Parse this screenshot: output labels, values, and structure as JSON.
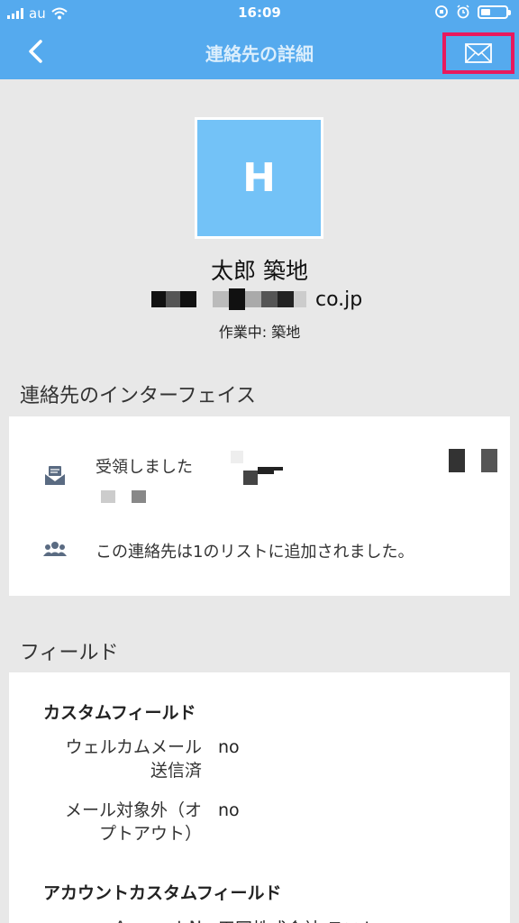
{
  "status_bar": {
    "carrier": "au",
    "time": "16:09",
    "battery_level": 0.4
  },
  "header": {
    "back_icon": "chevron-left-icon",
    "title": "連絡先の詳細",
    "mail_icon": "envelope-icon"
  },
  "contact": {
    "avatar_initial": "H",
    "name": "太郎 築地",
    "email_domain": "co.jp",
    "work": "作業中: 築地"
  },
  "interface_section": {
    "title": "連絡先のインターフェイス",
    "items": [
      {
        "icon": "mail-received-icon",
        "text": "受領しました"
      },
      {
        "icon": "people-icon",
        "text": "この連絡先は1のリストに追加されました。"
      }
    ]
  },
  "fields_section": {
    "title": "フィールド",
    "custom_title": "カスタムフィールド",
    "custom_fields": [
      {
        "label_line1": "ウェルカムメール",
        "label_line2": "送信済",
        "value": "no"
      },
      {
        "label_line1": "メール対象外（オ",
        "label_line2": "プトアウト）",
        "value": "no"
      }
    ],
    "account_title": "アカウントカスタムフィールド",
    "account_fields": [
      {
        "label": "Account N",
        "value": "平岡株式会社 テスト"
      }
    ]
  },
  "colors": {
    "header_bg": "#55aaee",
    "avatar_bg": "#73c2f7",
    "highlight": "#e8195e"
  }
}
